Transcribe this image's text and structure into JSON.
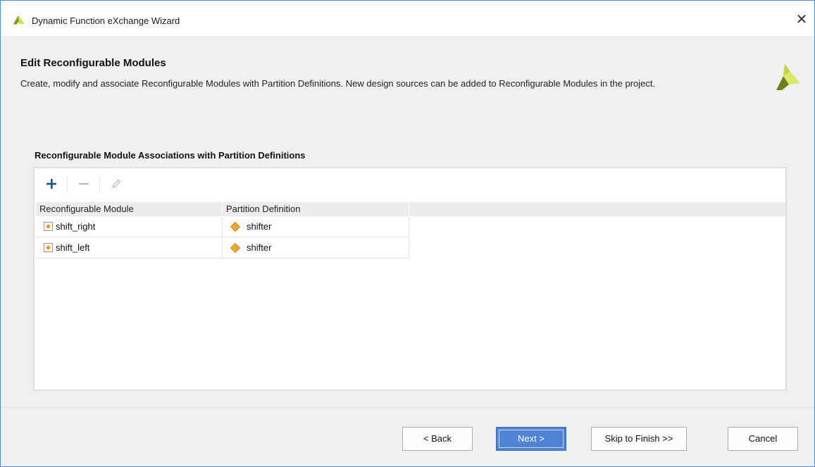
{
  "window": {
    "title": "Dynamic Function eXchange Wizard",
    "close_glyph": "✕"
  },
  "header": {
    "title": "Edit Reconfigurable Modules",
    "description": "Create, modify and associate Reconfigurable Modules with Partition Definitions. New design sources can be added to Reconfigurable Modules in the project."
  },
  "section": {
    "label": "Reconfigurable Module Associations with Partition Definitions"
  },
  "toolbar": {
    "add_icon": "plus-icon",
    "remove_icon": "minus-icon",
    "edit_icon": "pencil-icon"
  },
  "table": {
    "columns": [
      "Reconfigurable Module",
      "Partition Definition"
    ],
    "rows": [
      {
        "module": "shift_right",
        "partition": "shifter"
      },
      {
        "module": "shift_left",
        "partition": "shifter"
      }
    ]
  },
  "buttons": {
    "back": "< Back",
    "next": "Next >",
    "skip": "Skip to Finish >>",
    "cancel": "Cancel"
  },
  "colors": {
    "accent": "#4f83d6",
    "module_icon": "#f29a1f",
    "partition_icon": "#f0a832",
    "logo_light": "#c8d84a",
    "logo_dark": "#6b7a1e"
  }
}
